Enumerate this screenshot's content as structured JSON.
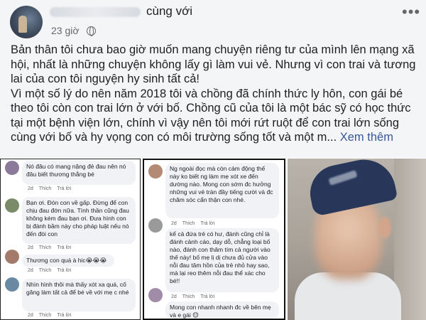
{
  "post": {
    "name_suffix": "cùng với",
    "time": "23 giờ",
    "more": "•••",
    "para1": "Bản thân tôi chưa bao giờ muốn mang chuyện riêng tư của mình lên mạng xã hội, nhất là những chuyện không lấy gì làm vui vẻ. Nhưng vì con trai và tương lai của con tôi nguyện hy sinh tất cả!",
    "para2": "Vì một số lý do nên năm 2018 tôi và chồng đã chính thức ly hôn, con gái bé theo tôi còn con trai lớn ở với bố. Chồng cũ của tôi là một bác sỹ có học thức tại một bệnh viện lớn, chính vì vậy nên tôi mới rứt ruột để con trai lớn sống cùng với bố và hy vọng con có môi trường sống tốt và một m...",
    "see_more": "Xem thêm"
  },
  "actions": {
    "like": "Thích",
    "reply": "Trả lời"
  },
  "left_comments": [
    "Nó đâu có mang nặng đẻ đau nên nó đâu biết thương thằng bé",
    "Bạn ơi. Đón con về gấp. Đừng để con chịu đau đớn nữa. Tình thần cũng đau không kém đau bạn ơi. Đưa hình con bị đánh bầm này cho pháp luật nếu nó đến đòi con",
    "Thương con quá à hic😭😭😭",
    "Nhìn hình thôi mà thấy xót xa quá, cố găng làm tất cả để bé về với mẹ c nhé"
  ],
  "mid_comments": [
    "Ng ngoài đọc mà còn cảm động thế này ko biết ng làm mẹ xót xe đến dường nào. Mong con sớm đc hưởng những vui vẻ tràn đầy tiếng cười và đc chăm sóc cẩn thận con nhé.",
    "kể cả đứa trẻ có hư, đánh cũng chỉ là đánh cảnh cáo, dạy dỗ, chẳng loại bố nào, đánh con thâm tím cả người vào thế này! bố mẹ lị dị chưa đủ cửa vào nỗi đau tâm hồn của trẻ nhỏ hay sao, mà lại reo thêm nỗi đau thể xác cho bé!!",
    "Mong con nhanh nhanh đc về bên mẹ và e gái 😊"
  ],
  "colors": {
    "see_more": "#385898",
    "text": "#1c1e21",
    "meta": "#65676b"
  }
}
